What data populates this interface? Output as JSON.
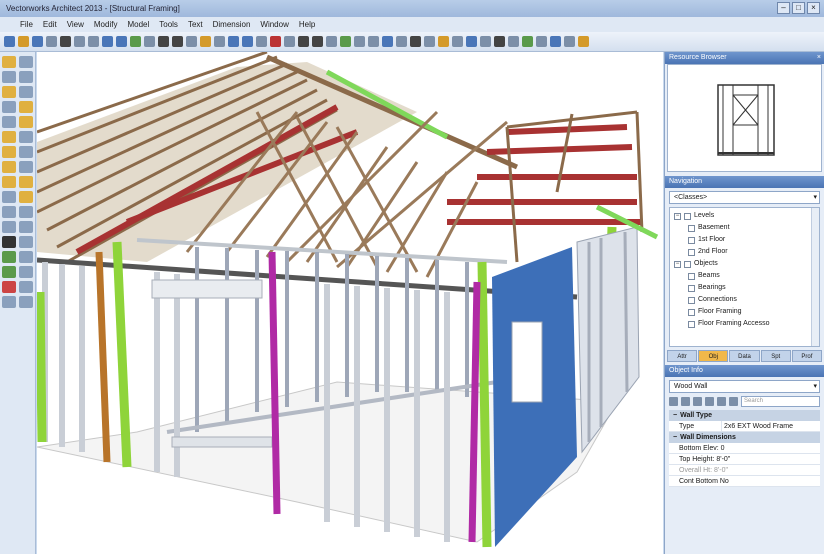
{
  "window": {
    "title": "Vectorworks Architect 2013 - [Structural Framing]",
    "controls": [
      "–",
      "□",
      "×"
    ]
  },
  "menu": [
    "File",
    "Edit",
    "View",
    "Modify",
    "Model",
    "Tools",
    "Text",
    "Dimension",
    "Window",
    "Help"
  ],
  "panels": {
    "resource_title": "Resource Browser",
    "navigation_title": "Navigation",
    "navigation_dropdown": "<Classes>",
    "tree": [
      {
        "label": "Levels",
        "expanded": true,
        "level": 0
      },
      {
        "label": "Basement",
        "level": 1
      },
      {
        "label": "1st Floor",
        "level": 1
      },
      {
        "label": "2nd Floor",
        "level": 1
      },
      {
        "label": "Objects",
        "expanded": true,
        "level": 0
      },
      {
        "label": "Beams",
        "level": 1
      },
      {
        "label": "Bearings",
        "level": 1
      },
      {
        "label": "Connections",
        "level": 1
      },
      {
        "label": "Floor Framing",
        "level": 1
      },
      {
        "label": "Floor Framing Accesso",
        "level": 1
      }
    ],
    "tabs": [
      "Attr",
      "Obj",
      "Data",
      "Spt",
      "Prof"
    ],
    "active_tab": 1,
    "object_info_title": "Object Info",
    "object_type": "Wood Wall",
    "search_placeholder": "Search"
  },
  "properties": {
    "section1": "Wall Type",
    "type_label": "Type",
    "type_value": "2x6 EXT Wood Frame",
    "section2": "Wall Dimensions",
    "rows": [
      "Bottom Elev: 0",
      "Top Height: 8'-0\"",
      "Overall Ht: 8'-0\"",
      "Cont Bottom No"
    ]
  },
  "colors": {
    "accent": "#4a74b4",
    "active_tab": "#f0b84a",
    "framing": "#8b6a4a",
    "green_stud": "#8fd43a",
    "magenta_stud": "#b02aa5",
    "red_member": "#a83232",
    "blue_panel": "#3d6fb8"
  }
}
